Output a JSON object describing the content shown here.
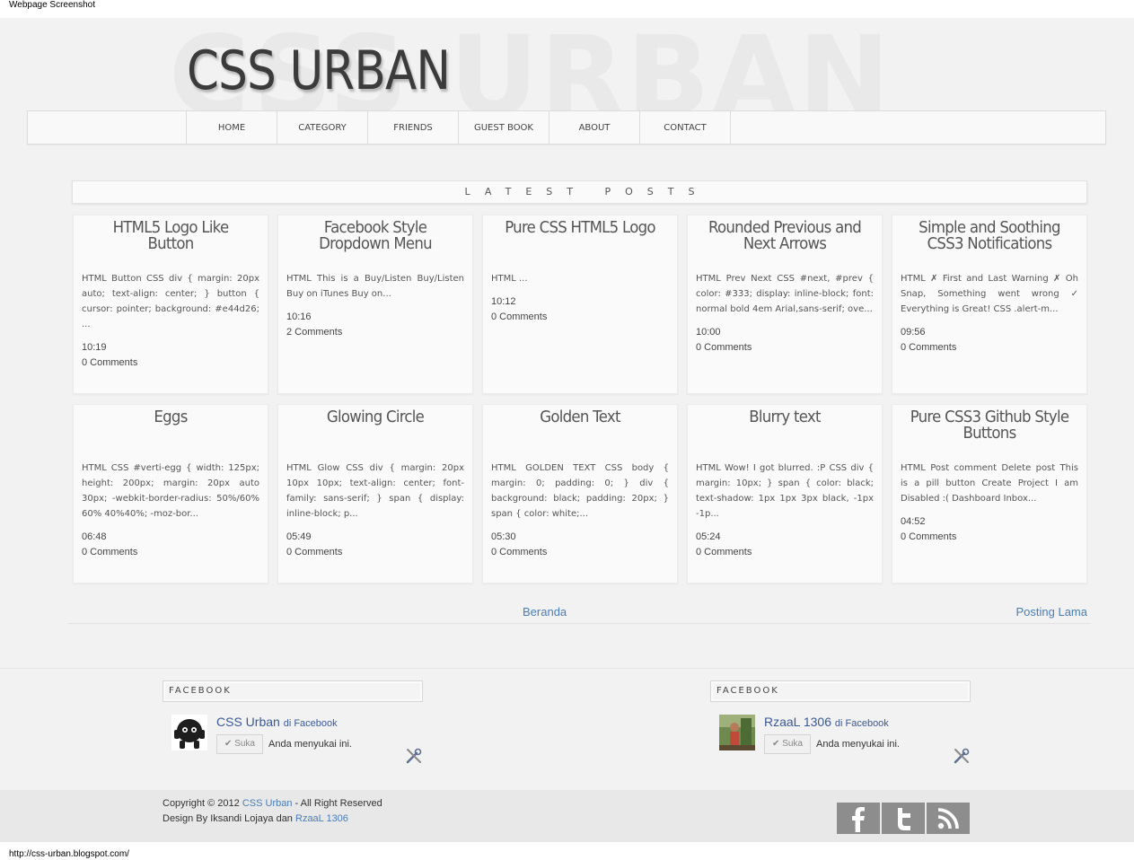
{
  "captions": {
    "top": "Webpage Screenshot",
    "bottom": "http://css-urban.blogspot.com/"
  },
  "header": {
    "logo": "CSS URBAN",
    "watermark": "CSS URBAN"
  },
  "nav": {
    "items": [
      "HOME",
      "CATEGORY",
      "FRIENDS",
      "GUEST BOOK",
      "ABOUT",
      "CONTACT"
    ]
  },
  "latest_posts_label": "LATEST POSTS",
  "posts": [
    {
      "title": "HTML5 Logo Like Button",
      "excerpt": "HTML Button CSS div { margin: 20px auto; text-align: center; } button { cursor: pointer; background: #e44d26; ...",
      "time": "10:19",
      "comments": "0 Comments"
    },
    {
      "title": "Facebook Style Dropdown Menu",
      "excerpt": "HTML This is a Buy/Listen Buy/Listen Buy on iTunes Buy on...",
      "time": "10:16",
      "comments": "2 Comments"
    },
    {
      "title": "Pure CSS HTML5 Logo",
      "excerpt": "HTML ...",
      "time": "10:12",
      "comments": "0 Comments"
    },
    {
      "title": "Rounded Previous and Next Arrows",
      "excerpt": "HTML Prev Next CSS #next, #prev { color: #333; display: inline-block; font: normal bold 4em Arial,sans-serif; ove...",
      "time": "10:00",
      "comments": "0 Comments"
    },
    {
      "title": "Simple and Soothing CSS3 Notifications",
      "excerpt": "HTML ✗ First and Last Warning ✗ Oh Snap, Something went wrong ✓ Everything is Great! CSS .alert-m...",
      "time": "09:56",
      "comments": "0 Comments"
    },
    {
      "title": "Eggs",
      "excerpt": "HTML CSS #verti-egg { width: 125px; height: 200px; margin: 20px auto 30px; -webkit-border-radius: 50%/60% 60% 40%40%; -moz-bor...",
      "time": "06:48",
      "comments": "0 Comments"
    },
    {
      "title": "Glowing Circle",
      "excerpt": "HTML Glow CSS div { margin: 20px 10px 10px; text-align: center; font-family: sans-serif; } span { display: inline-block; p...",
      "time": "05:49",
      "comments": "0 Comments"
    },
    {
      "title": "Golden Text",
      "excerpt": "HTML GOLDEN TEXT CSS body { margin: 0; padding: 0; } div { background: black; padding: 20px; } span { color: white;...",
      "time": "05:30",
      "comments": "0 Comments"
    },
    {
      "title": "Blurry text",
      "excerpt": "HTML Wow! I got blurred. :P CSS div { margin: 10px; } span { color: black; text-shadow: 1px 1px 3px black, -1px -1p...",
      "time": "05:24",
      "comments": "0 Comments"
    },
    {
      "title": "Pure CSS3 Github Style Buttons",
      "excerpt": "HTML Post comment Delete post This is a pill button Create Project I am Disabled :( Dashboard Inbox...",
      "time": "04:52",
      "comments": "0 Comments"
    }
  ],
  "pager": {
    "home": "Beranda",
    "older": "Posting Lama"
  },
  "facebook_widgets": [
    {
      "header": "FACEBOOK",
      "name": "CSS Urban",
      "suffix": "di Facebook",
      "like": "Suka",
      "liked_text": "Anda menyukai ini."
    },
    {
      "header": "FACEBOOK",
      "name": "RzaaL 1306",
      "suffix": "di Facebook",
      "like": "Suka",
      "liked_text": "Anda menyukai ini."
    }
  ],
  "footer": {
    "copyright_prefix": "Copyright © 2012",
    "copyright_link": "CSS Urban",
    "copyright_suffix": "- All Right Reserved",
    "design_prefix": "Design By Iksandi Lojaya dan",
    "design_link": "RzaaL 1306",
    "social": [
      "facebook-icon",
      "twitter-icon",
      "rss-icon"
    ]
  },
  "colors": {
    "page_bg": "#f2f2f2",
    "link": "#4a7db8",
    "facebook_blue": "#3b5998",
    "social_gray": "#8d8d8d"
  }
}
